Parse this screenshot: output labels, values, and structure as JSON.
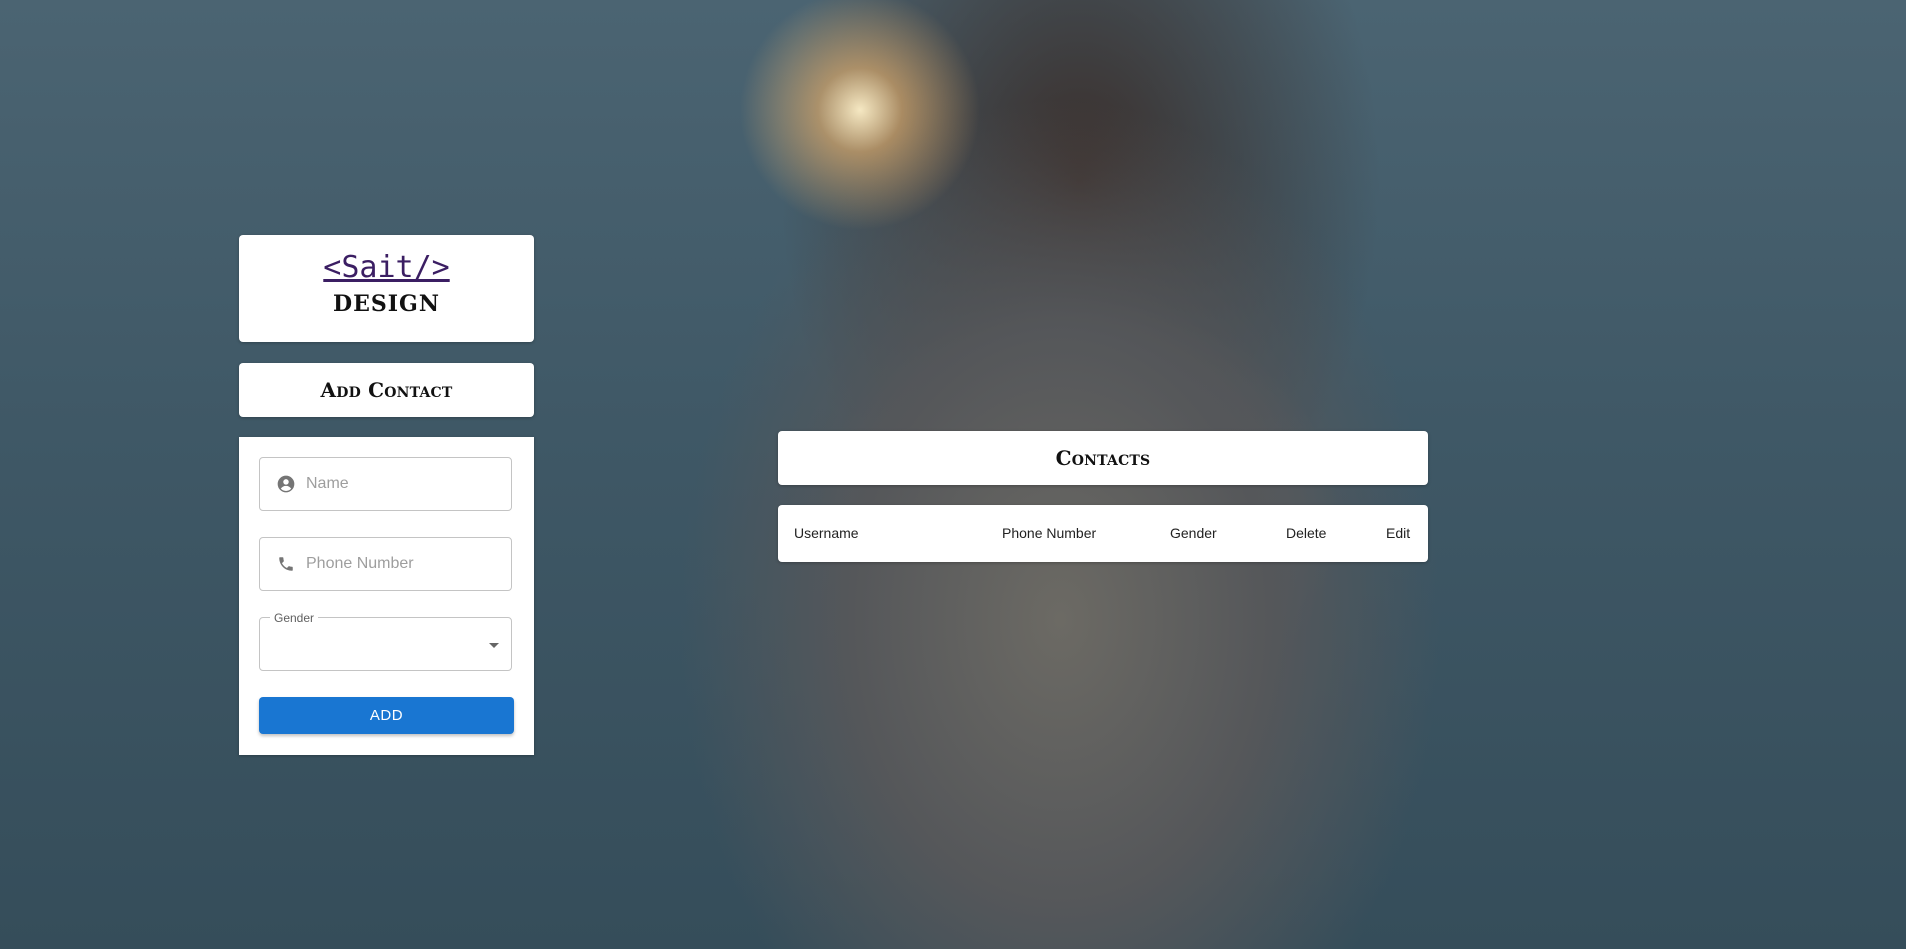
{
  "logo": {
    "text": "<Sait/>",
    "subtitle": "DESIGN"
  },
  "add_contact": {
    "title": "Add Contact",
    "name_placeholder": "Name",
    "name_icon": "account-circle-icon",
    "phone_placeholder": "Phone Number",
    "phone_icon": "phone-icon",
    "gender_label": "Gender",
    "add_button_label": "ADD"
  },
  "contacts": {
    "title": "Contacts",
    "columns": [
      "Username",
      "Phone Number",
      "Gender",
      "Delete",
      "Edit"
    ]
  },
  "colors": {
    "accent": "#1976d2",
    "logo": "#3b1e63",
    "card": "#ffffff"
  }
}
